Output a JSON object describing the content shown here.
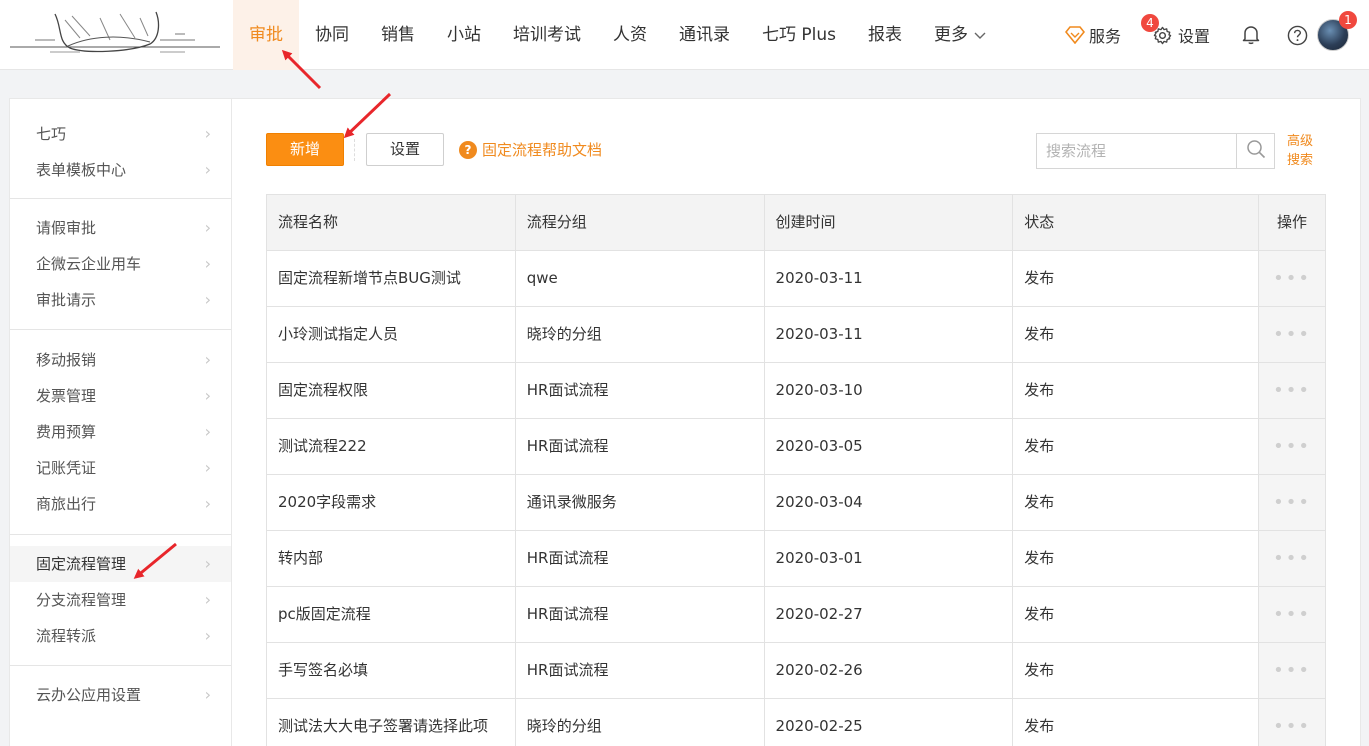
{
  "nav": {
    "items": [
      {
        "label": "审批",
        "active": true
      },
      {
        "label": "协同"
      },
      {
        "label": "销售"
      },
      {
        "label": "小站"
      },
      {
        "label": "培训考试"
      },
      {
        "label": "人资"
      },
      {
        "label": "通讯录"
      },
      {
        "label": "七巧 Plus"
      },
      {
        "label": "报表"
      }
    ],
    "more_label": "更多"
  },
  "tools": {
    "service_label": "服务",
    "service_badge": "4",
    "settings_label": "设置",
    "avatar_badge": "1"
  },
  "sidebar": {
    "groups": [
      [
        "七巧",
        "表单模板中心"
      ],
      [
        "请假审批",
        "企微云企业用车",
        "审批请示"
      ],
      [
        "移动报销",
        "发票管理",
        "费用预算",
        "记账凭证",
        "商旅出行"
      ],
      [
        "固定流程管理",
        "分支流程管理",
        "流程转派"
      ],
      [
        "云办公应用设置"
      ]
    ],
    "active": "固定流程管理"
  },
  "toolbar": {
    "add_label": "新增",
    "settings_label": "设置",
    "help_label": "固定流程帮助文档",
    "search_placeholder": "搜索流程",
    "advanced_line1": "高级",
    "advanced_line2": "搜索"
  },
  "table": {
    "headers": [
      "流程名称",
      "流程分组",
      "创建时间",
      "状态",
      "操作"
    ],
    "rows": [
      [
        "固定流程新增节点BUG测试",
        "qwe",
        "2020-03-11",
        "发布"
      ],
      [
        "小玲测试指定人员",
        "晓玲的分组",
        "2020-03-11",
        "发布"
      ],
      [
        "固定流程权限",
        "HR面试流程",
        "2020-03-10",
        "发布"
      ],
      [
        "测试流程222",
        "HR面试流程",
        "2020-03-05",
        "发布"
      ],
      [
        "2020字段需求",
        "通讯录微服务",
        "2020-03-04",
        "发布"
      ],
      [
        "转内部",
        "HR面试流程",
        "2020-03-01",
        "发布"
      ],
      [
        "pc版固定流程",
        "HR面试流程",
        "2020-02-27",
        "发布"
      ],
      [
        "手写签名必填",
        "HR面试流程",
        "2020-02-26",
        "发布"
      ],
      [
        "测试法大大电子签署请选择此项",
        "晓玲的分组",
        "2020-02-25",
        "发布"
      ]
    ],
    "action_glyph": "•••"
  },
  "colors": {
    "accent": "#f08a1e",
    "primary_button": "#fb8e12",
    "badge": "#f0483e",
    "annotation_arrow": "#e8262b"
  }
}
